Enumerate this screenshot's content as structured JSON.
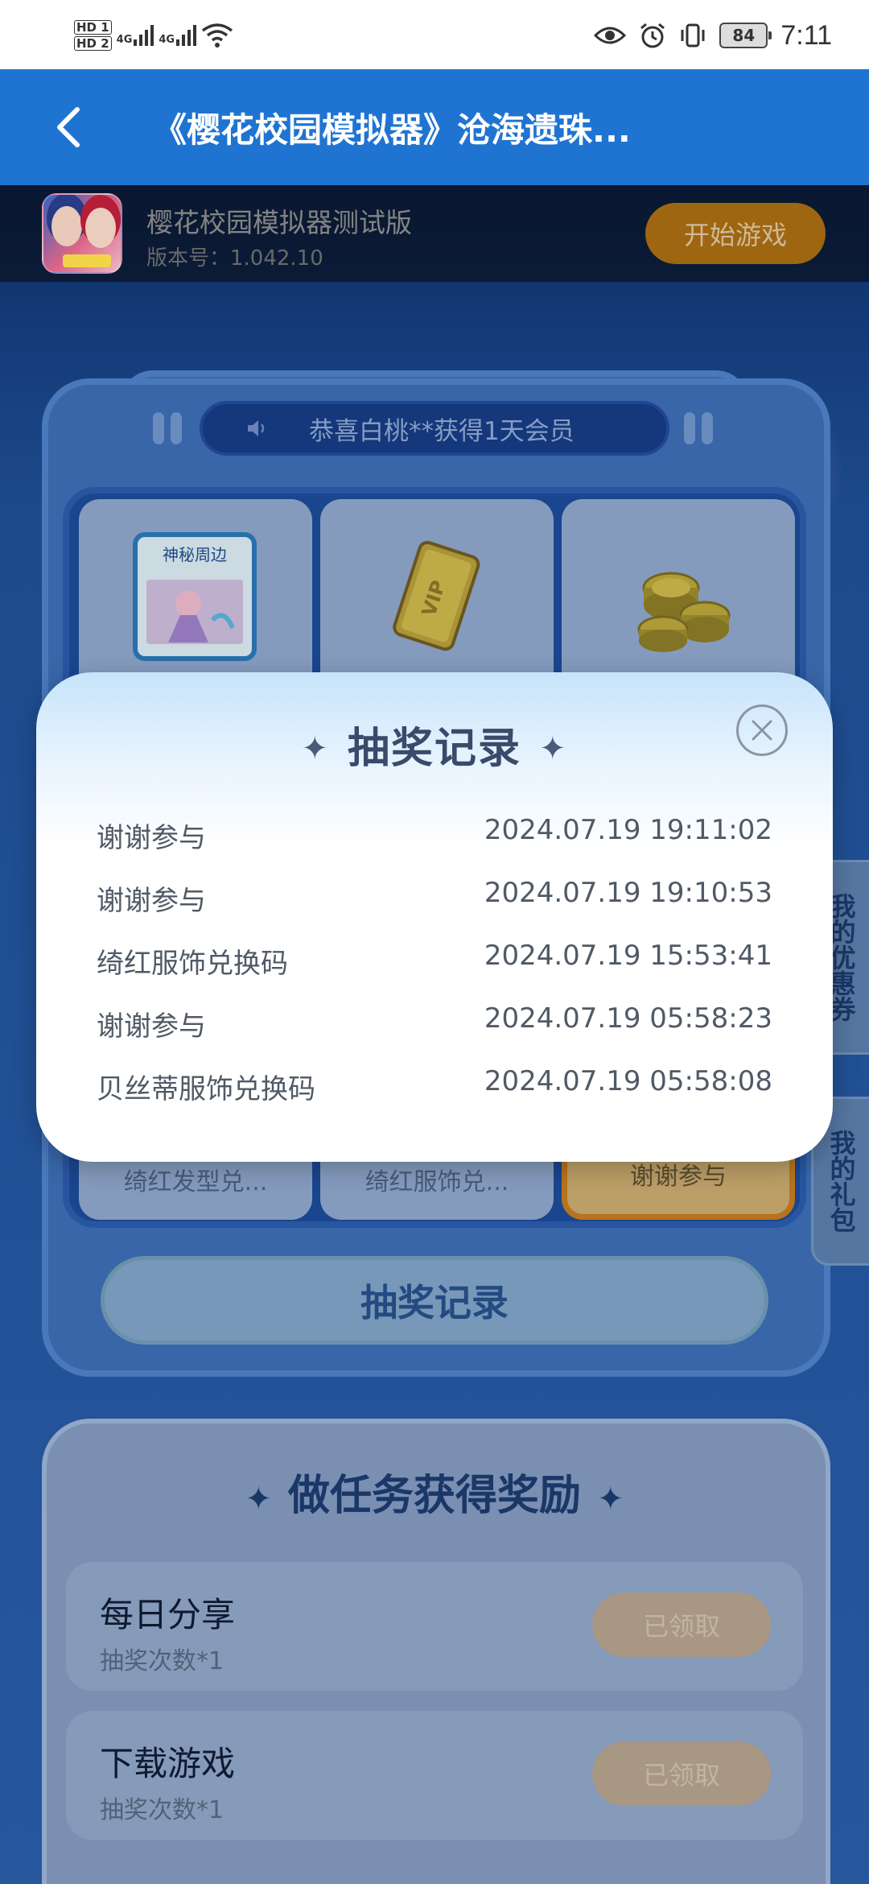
{
  "status_bar": {
    "hd1": "HD 1",
    "hd2": "HD 2",
    "net1": "4G",
    "net2": "4G",
    "battery": "84",
    "time": "7:11",
    "icons": [
      "eye-icon",
      "alarm-icon",
      "vibrate-icon",
      "wifi-icon"
    ]
  },
  "header": {
    "title": "《樱花校园模拟器》沧海遗珠..."
  },
  "game_bar": {
    "name": "樱花校园模拟器测试版",
    "version": "版本号：1.042.10",
    "start_button": "开始游戏"
  },
  "ticker": {
    "text": "恭喜白桃**获得1天会员"
  },
  "prize_grid": {
    "top_cards": [
      {
        "caption": "神秘周边",
        "icon": "mystery-merch-icon"
      },
      {
        "caption": "VIP",
        "icon": "vip-card-icon"
      },
      {
        "caption": "",
        "icon": "gold-coins-icon"
      }
    ],
    "bottom_cards": [
      {
        "label": "绮红发型兑..."
      },
      {
        "label": "绮红服饰兑..."
      },
      {
        "label": "谢谢参与"
      }
    ]
  },
  "draw_record_button": "抽奖记录",
  "tasks": {
    "title": "做任务获得奖励",
    "items": [
      {
        "name": "每日分享",
        "reward": "抽奖次数*1",
        "status": "已领取"
      },
      {
        "name": "下载游戏",
        "reward": "抽奖次数*1",
        "status": "已领取"
      }
    ]
  },
  "side_tabs": {
    "coupons": "我的优惠券",
    "gifts": "我的礼包"
  },
  "modal": {
    "title": "抽奖记录",
    "records": [
      {
        "name": "谢谢参与",
        "time": "2024.07.19 19:11:02"
      },
      {
        "name": "谢谢参与",
        "time": "2024.07.19 19:10:53"
      },
      {
        "name": "绮红服饰兑换码",
        "time": "2024.07.19 15:53:41"
      },
      {
        "name": "谢谢参与",
        "time": "2024.07.19 05:58:23"
      },
      {
        "name": "贝丝蒂服饰兑换码",
        "time": "2024.07.19 05:58:08"
      }
    ]
  },
  "colors": {
    "header_blue": "#1f74d2",
    "start_orange": "#a86c12",
    "panel_blue": "#3b6cb2"
  }
}
